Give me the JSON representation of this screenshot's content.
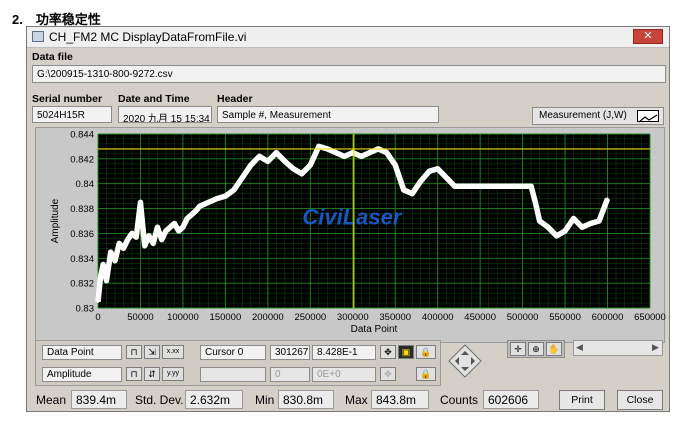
{
  "doc_heading": "2.　功率稳定性",
  "window": {
    "title": "CH_FM2 MC DisplayDataFromFile.vi",
    "close_label": "✕"
  },
  "data_file": {
    "label": "Data file",
    "value": "G:\\200915-1310-800-9272.csv"
  },
  "serial": {
    "label": "Serial number",
    "value": "5024H15R"
  },
  "datetime": {
    "label": "Date and Time",
    "value": "2020 九月 15 15:34"
  },
  "header": {
    "label": "Header",
    "value": "Sample #, Measurement"
  },
  "plot_legend": {
    "label": "Measurement (J,W)",
    "line_color": "#ffffff"
  },
  "watermark": "CiviLaser",
  "colors": {
    "plot_bg": "#000000",
    "grid": "#1e8a1e",
    "cursor": "#e8e000",
    "trace": "#ffffff",
    "watermark": "#1a5fd4"
  },
  "chart_data": {
    "type": "line",
    "xlabel": "Data Point",
    "ylabel": "Amplitude",
    "xlim": [
      0,
      650000
    ],
    "ylim": [
      0.83,
      0.844
    ],
    "x_ticks": [
      "0",
      "50000",
      "100000",
      "150000",
      "200000",
      "250000",
      "300000",
      "350000",
      "400000",
      "450000",
      "500000",
      "550000",
      "600000",
      "650000"
    ],
    "y_ticks": [
      "0.844",
      "0.842",
      "0.84",
      "0.838",
      "0.836",
      "0.834",
      "0.832",
      "0.83"
    ],
    "cursor_x": 301267,
    "cursor_y": 0.8428,
    "series": [
      {
        "x": [
          0,
          3000,
          6000,
          10000,
          15000,
          20000,
          25000,
          30000,
          35000,
          40000,
          45000,
          50000,
          55000,
          60000,
          65000,
          70000,
          75000,
          80000,
          85000,
          90000,
          95000,
          100000,
          105000,
          110000,
          115000,
          120000,
          130000,
          140000,
          150000,
          160000,
          170000,
          180000,
          190000,
          200000,
          210000,
          220000,
          230000,
          240000,
          250000,
          260000,
          270000,
          280000,
          290000,
          300000,
          310000,
          320000,
          330000,
          340000,
          350000,
          360000,
          370000,
          380000,
          390000,
          400000,
          410000,
          420000,
          430000,
          440000,
          450000,
          460000,
          470000,
          480000,
          490000,
          500000,
          510000,
          515000,
          520000,
          530000,
          540000,
          550000,
          560000,
          570000,
          580000,
          590000,
          600000
        ],
        "y": [
          0.8305,
          0.8325,
          0.8335,
          0.8322,
          0.8345,
          0.8338,
          0.8352,
          0.8348,
          0.8355,
          0.836,
          0.8357,
          0.8385,
          0.835,
          0.8358,
          0.8352,
          0.8365,
          0.8355,
          0.8362,
          0.8365,
          0.8368,
          0.8362,
          0.8365,
          0.8372,
          0.8375,
          0.8378,
          0.8382,
          0.8385,
          0.8388,
          0.839,
          0.8395,
          0.8405,
          0.8415,
          0.8422,
          0.8418,
          0.8425,
          0.8418,
          0.8412,
          0.8408,
          0.8415,
          0.843,
          0.8428,
          0.8425,
          0.8422,
          0.8425,
          0.8422,
          0.8425,
          0.8428,
          0.8425,
          0.8415,
          0.8395,
          0.8392,
          0.8402,
          0.841,
          0.8412,
          0.8405,
          0.8398,
          0.8398,
          0.8398,
          0.8398,
          0.8398,
          0.8398,
          0.8398,
          0.8398,
          0.8398,
          0.8398,
          0.8385,
          0.837,
          0.8365,
          0.8358,
          0.8362,
          0.8372,
          0.8365,
          0.8368,
          0.837,
          0.8388
        ]
      }
    ]
  },
  "controls": {
    "plot0_name": "Data Point",
    "plot1_name": "Amplitude",
    "lock0": "🔒",
    "lock1": "🔒",
    "xfmt0": "x.xx",
    "xfmt1": "y.yy",
    "cursor_name": "Cursor 0",
    "cursor_x": "301267",
    "cursor_y": "8.428E-1",
    "cursor2_x": "0",
    "cursor2_y": "0E+0"
  },
  "stats": {
    "mean_label": "Mean",
    "mean_value": "839.4m",
    "std_label": "Std. Dev.",
    "std_value": "2.632m",
    "min_label": "Min",
    "min_value": "830.8m",
    "max_label": "Max",
    "max_value": "843.8m",
    "counts_label": "Counts",
    "counts_value": "602606"
  },
  "buttons": {
    "print": "Print",
    "close": "Close"
  }
}
